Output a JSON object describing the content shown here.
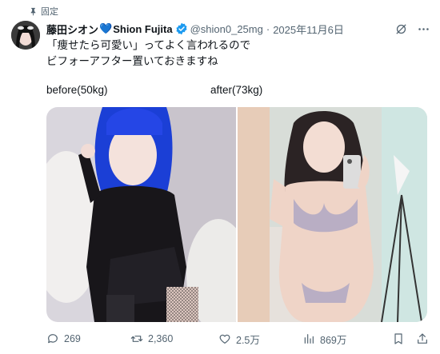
{
  "pinned_label": "固定",
  "author": {
    "display_name": "藤田シオン",
    "heart": "💙",
    "display_name_en": "Shion Fujita",
    "handle": "@shion0_25mg",
    "separator": "·",
    "date": "2025年11月6日"
  },
  "tweet": {
    "line1": "「痩せたら可愛い」ってよく言われるので",
    "line2": "ビフォーアフター置いておきますね"
  },
  "photos": {
    "before_label": "before(50kg)",
    "after_label": "after(73kg)"
  },
  "actions": {
    "replies": "269",
    "reposts": "2,360",
    "likes": "2.5万",
    "views": "869万"
  },
  "colors": {
    "verified": "#1d9bf0",
    "secondary_text": "#536471",
    "heart": "#5eaee8"
  }
}
